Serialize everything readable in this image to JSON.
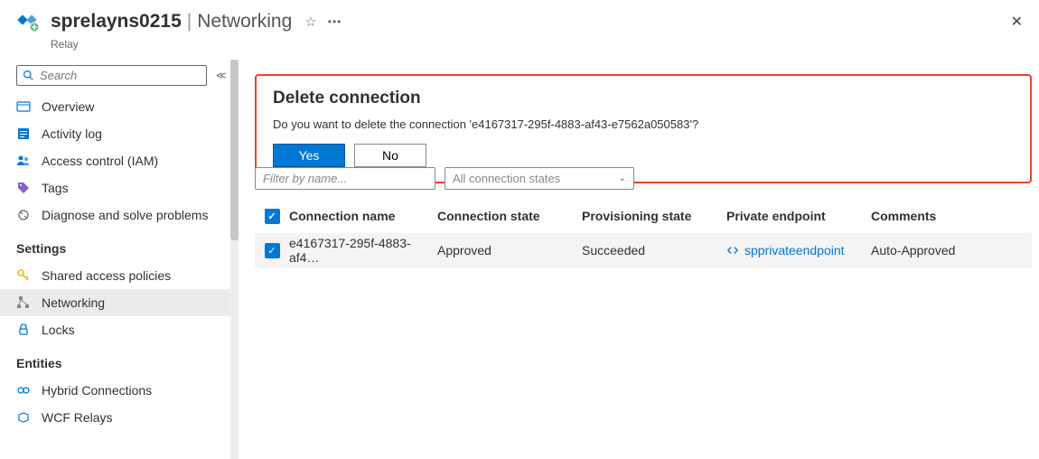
{
  "header": {
    "resource_name": "sprelayns0215",
    "section": "Networking",
    "resource_type": "Relay"
  },
  "sidebar": {
    "search_placeholder": "Search",
    "items": [
      {
        "label": "Overview",
        "icon": "overview"
      },
      {
        "label": "Activity log",
        "icon": "activity"
      },
      {
        "label": "Access control (IAM)",
        "icon": "access"
      },
      {
        "label": "Tags",
        "icon": "tags"
      },
      {
        "label": "Diagnose and solve problems",
        "icon": "diagnose"
      }
    ],
    "group_settings": {
      "label": "Settings",
      "items": [
        {
          "label": "Shared access policies",
          "icon": "key"
        },
        {
          "label": "Networking",
          "icon": "networking",
          "selected": true
        },
        {
          "label": "Locks",
          "icon": "lock"
        }
      ]
    },
    "group_entities": {
      "label": "Entities",
      "items": [
        {
          "label": "Hybrid Connections",
          "icon": "hybrid"
        },
        {
          "label": "WCF Relays",
          "icon": "wcf"
        }
      ]
    }
  },
  "dialog": {
    "title": "Delete connection",
    "message": "Do you want to delete the connection 'e4167317-295f-4883-af43-e7562a050583'?",
    "yes_label": "Yes",
    "no_label": "No"
  },
  "filters": {
    "name_placeholder": "Filter by name...",
    "state_label": "All connection states"
  },
  "table": {
    "headers": {
      "conn_name": "Connection name",
      "conn_state": "Connection state",
      "prov_state": "Provisioning state",
      "priv_ep": "Private endpoint",
      "comments": "Comments"
    },
    "rows": [
      {
        "conn_name": "e4167317-295f-4883-af4…",
        "conn_state": "Approved",
        "prov_state": "Succeeded",
        "priv_ep": "spprivateendpoint",
        "comments": "Auto-Approved"
      }
    ]
  }
}
